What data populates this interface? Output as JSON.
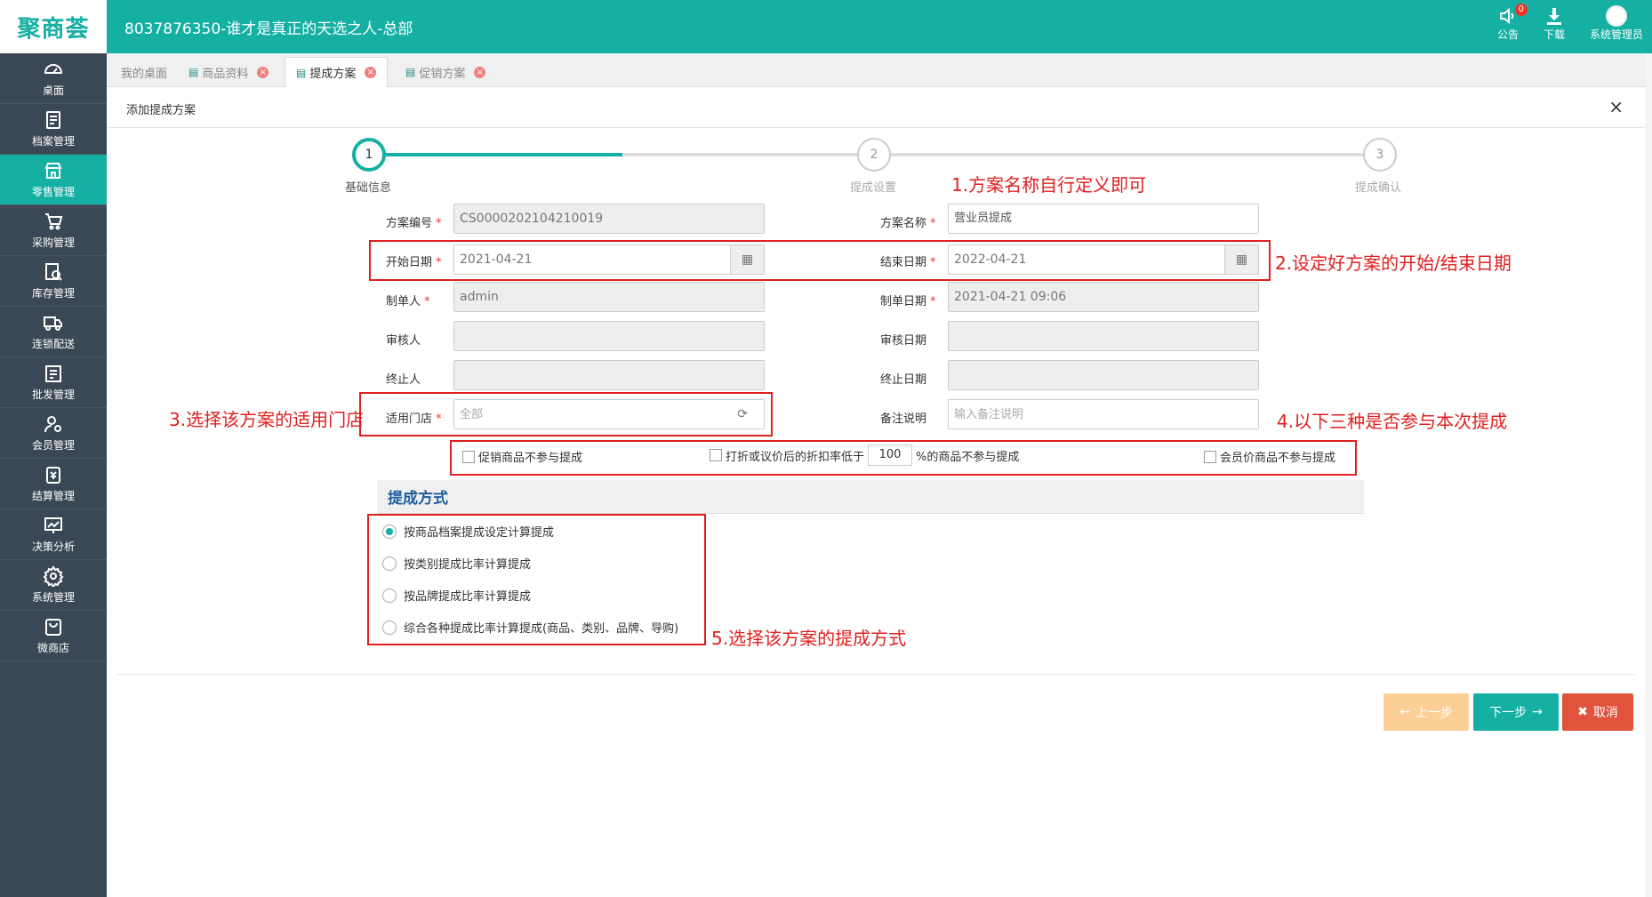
{
  "header": {
    "logo": "聚商荟",
    "title": "8037876350-谁才是真正的天选之人-总部",
    "notice_label": "公告",
    "notice_count": "0",
    "download_label": "下载",
    "user_label": "系统管理员"
  },
  "sidebar": {
    "items": [
      {
        "label": "桌面",
        "icon": "dashboard-icon"
      },
      {
        "label": "档案管理",
        "icon": "archive-icon"
      },
      {
        "label": "零售管理",
        "icon": "store-icon"
      },
      {
        "label": "采购管理",
        "icon": "cart-icon"
      },
      {
        "label": "库存管理",
        "icon": "inventory-icon"
      },
      {
        "label": "连锁配送",
        "icon": "truck-icon"
      },
      {
        "label": "批发管理",
        "icon": "wholesale-icon"
      },
      {
        "label": "会员管理",
        "icon": "member-icon"
      },
      {
        "label": "结算管理",
        "icon": "settlement-icon"
      },
      {
        "label": "决策分析",
        "icon": "chart-icon"
      },
      {
        "label": "系统管理",
        "icon": "gear-icon"
      },
      {
        "label": "微商店",
        "icon": "shop-bag-icon"
      }
    ]
  },
  "tabs": [
    {
      "label": "我的桌面"
    },
    {
      "label": "商品资料"
    },
    {
      "label": "提成方案"
    },
    {
      "label": "促销方案"
    }
  ],
  "panel": {
    "title": "添加提成方案"
  },
  "steps": [
    {
      "num": "1",
      "label": "基础信息"
    },
    {
      "num": "2",
      "label": "提成设置"
    },
    {
      "num": "3",
      "label": "提成确认"
    }
  ],
  "form": {
    "scheme_no_label": "方案编号",
    "scheme_no": "CS0000202104210019",
    "scheme_name_label": "方案名称",
    "scheme_name": "营业员提成",
    "start_label": "开始日期",
    "start": "2021-04-21",
    "end_label": "结束日期",
    "end": "2022-04-21",
    "maker_label": "制单人",
    "maker": "admin",
    "make_date_label": "制单日期",
    "make_date": "2021-04-21 09:06",
    "auditor_label": "审核人",
    "audit_date_label": "审核日期",
    "terminator_label": "终止人",
    "term_date_label": "终止日期",
    "store_label": "适用门店",
    "store": "全部",
    "remark_label": "备注说明",
    "remark_placeholder": "输入备注说明",
    "chk1": "促销商品不参与提成",
    "chk2_pre": "打折或议价后的折扣率低于",
    "chk2_value": "100",
    "chk2_post": "%的商品不参与提成",
    "chk3": "会员价商品不参与提成"
  },
  "method": {
    "title": "提成方式",
    "options": [
      "按商品档案提成设定计算提成",
      "按类别提成比率计算提成",
      "按品牌提成比率计算提成",
      "综合各种提成比率计算提成(商品、类别、品牌、导购)"
    ],
    "selected": 0
  },
  "notes": {
    "n1": "1.方案名称自行定义即可",
    "n2": "2.设定好方案的开始/结束日期",
    "n3": "3.选择该方案的适用门店",
    "n4": "4.以下三种是否参与本次提成",
    "n5": "5.选择该方案的提成方式"
  },
  "buttons": {
    "prev": "上一步",
    "next": "下一步",
    "cancel": "取消"
  },
  "colors": {
    "brand": "#15b0a3",
    "annotation": "#e02020",
    "sidebar": "#394854"
  }
}
